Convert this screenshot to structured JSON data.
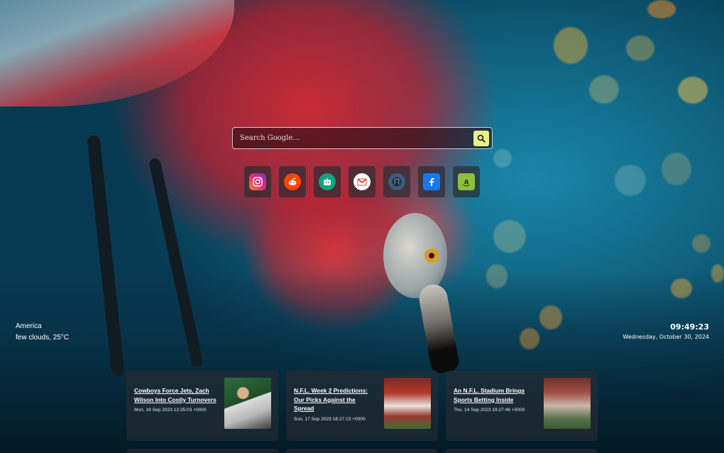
{
  "search": {
    "placeholder": "Search Google..."
  },
  "shortcuts": [
    {
      "name": "instagram",
      "icon": "instagram-icon",
      "color": "#e1306c"
    },
    {
      "name": "reddit",
      "icon": "reddit-icon",
      "color": "#ff4500"
    },
    {
      "name": "chatgpt",
      "icon": "bot-icon",
      "color": "#10a37f"
    },
    {
      "name": "gmail",
      "icon": "gmail-icon",
      "color": "#ea4335"
    },
    {
      "name": "github",
      "icon": "github-icon",
      "color": "#2b3137"
    },
    {
      "name": "facebook",
      "icon": "facebook-icon",
      "color": "#1877f2"
    },
    {
      "name": "amazon",
      "icon": "amazon-icon",
      "color": "#8fbf3f"
    }
  ],
  "weather": {
    "location": "America",
    "condition": "few clouds, 25°C"
  },
  "clock": {
    "time": "09:49:23",
    "date": "Wednesday, October 30, 2024"
  },
  "news": [
    {
      "title": "Cowboys Force Jets, Zach Wilson Into Costly Turnovers",
      "date": "Mon, 18 Sep 2023 12:35:03 +0000"
    },
    {
      "title": "N.F.L. Week 2 Predictions: Our Picks Against the Spread",
      "date": "Sun, 17 Sep 2023 18:27:13 +0000"
    },
    {
      "title": "An N.F.L. Stadium Brings Sports Betting Inside",
      "date": "Thu, 14 Sep 2023 19:27:46 +0000"
    }
  ]
}
